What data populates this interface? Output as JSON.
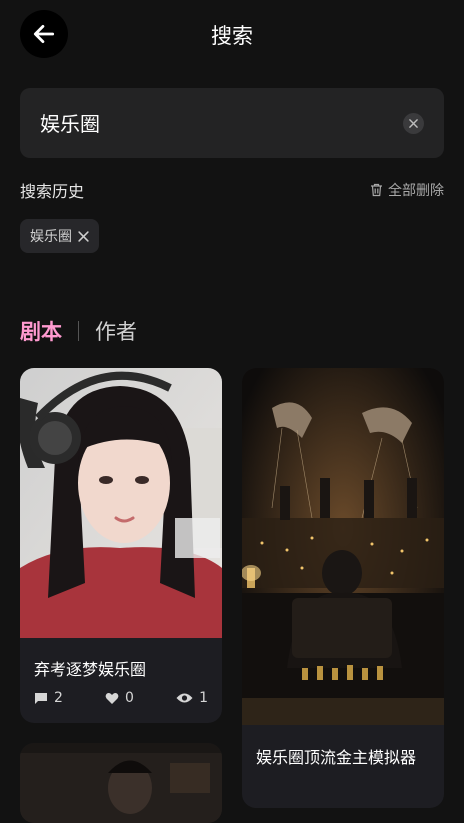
{
  "header": {
    "title": "搜索"
  },
  "search": {
    "value": "娱乐圈"
  },
  "history": {
    "title": "搜索历史",
    "delete_all_label": "全部删除",
    "items": [
      "娱乐圈"
    ]
  },
  "tabs": [
    {
      "label": "剧本",
      "active": true
    },
    {
      "label": "作者",
      "active": false
    }
  ],
  "cards": [
    {
      "title": "弃考逐梦娱乐圈",
      "comments": "2",
      "likes": "0",
      "views": "1"
    },
    {
      "title": "娱乐圈顶流金主模拟器"
    }
  ],
  "colors": {
    "accent": "#ff9ad0",
    "background": "#121212",
    "card": "#1d1d22"
  }
}
